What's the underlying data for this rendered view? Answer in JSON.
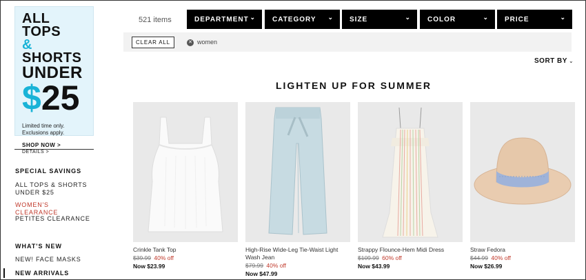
{
  "promo": {
    "line1": "ALL TOPS",
    "amp": "&",
    "line2": "SHORTS",
    "line3": "UNDER",
    "dollar": "$",
    "amount": "25",
    "note1": "Limited time only.",
    "note2": "Exclusions apply.",
    "shop_now": "SHOP NOW >",
    "details": "DETAILS >"
  },
  "sidebar": {
    "special_head": "SPECIAL SAVINGS",
    "special_items": [
      "ALL TOPS & SHORTS UNDER $25",
      "WOMEN'S CLEARANCE",
      "PETITES CLEARANCE"
    ],
    "whatsnew_head": "WHAT'S NEW",
    "whatsnew_items": [
      "NEW! FACE MASKS",
      "NEW ARRIVALS"
    ]
  },
  "filters": {
    "item_count": "521 items",
    "buttons": [
      "DEPARTMENT",
      "CATEGORY",
      "SIZE",
      "COLOR",
      "PRICE"
    ],
    "clear_all": "CLEAR ALL",
    "active_chip": "women",
    "sort_by": "SORT BY"
  },
  "section_title": "LIGHTEN UP FOR SUMMER",
  "products": [
    {
      "name": "Crinkle Tank Top",
      "orig": "$39.99",
      "off": "40% off",
      "now": "Now $23.99"
    },
    {
      "name": "High-Rise Wide-Leg Tie-Waist Light Wash Jean",
      "orig": "$79.99",
      "off": "40% off",
      "now": "Now $47.99"
    },
    {
      "name": "Strappy Flounce-Hem Midi Dress",
      "orig": "$109.99",
      "off": "60% off",
      "now": "Now $43.99"
    },
    {
      "name": "Straw Fedora",
      "orig": "$44.99",
      "off": "40% off",
      "now": "Now $26.99"
    }
  ],
  "colors": {
    "accent_blue": "#19b3d7",
    "sale_red": "#c0392b",
    "promo_bg": "#e3f4fb"
  }
}
